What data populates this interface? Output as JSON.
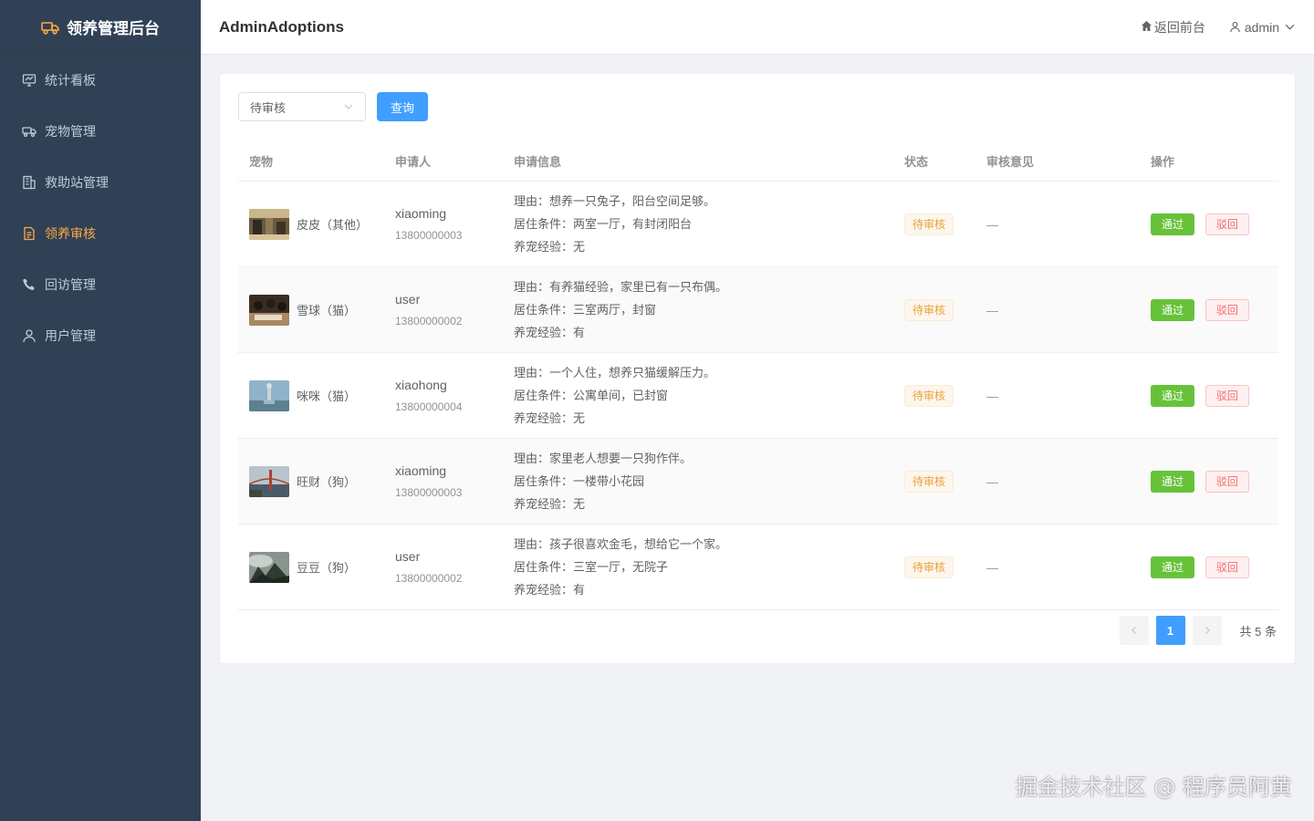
{
  "brand": {
    "title": "领养管理后台",
    "icon": "truck-icon",
    "accent": "#ffa940"
  },
  "sidebar": {
    "items": [
      {
        "label": "统计看板",
        "icon": "dashboard-icon",
        "active": false
      },
      {
        "label": "宠物管理",
        "icon": "truck-icon",
        "active": false
      },
      {
        "label": "救助站管理",
        "icon": "building-icon",
        "active": false
      },
      {
        "label": "领养审核",
        "icon": "document-icon",
        "active": true
      },
      {
        "label": "回访管理",
        "icon": "phone-icon",
        "active": false
      },
      {
        "label": "用户管理",
        "icon": "user-icon",
        "active": false
      }
    ]
  },
  "header": {
    "title": "AdminAdoptions",
    "back_link": "返回前台",
    "user": "admin"
  },
  "filter": {
    "status_value": "待审核",
    "query_label": "查询"
  },
  "table": {
    "columns": [
      "宠物",
      "申请人",
      "申请信息",
      "状态",
      "审核意见",
      "操作"
    ],
    "rows": [
      {
        "pet": "皮皮（其他）",
        "applicant": "xiaoming",
        "phone": "13800000003",
        "reason": "理由：想养一只兔子，阳台空间足够。",
        "living": "居住条件：两室一厅，有封闭阳台",
        "experience": "养宠经验：无",
        "status": "待审核",
        "review": "—",
        "approve": "通过",
        "reject": "驳回"
      },
      {
        "pet": "雪球（猫）",
        "applicant": "user",
        "phone": "13800000002",
        "reason": "理由：有养猫经验，家里已有一只布偶。",
        "living": "居住条件：三室两厅，封窗",
        "experience": "养宠经验：有",
        "status": "待审核",
        "review": "—",
        "approve": "通过",
        "reject": "驳回"
      },
      {
        "pet": "咪咪（猫）",
        "applicant": "xiaohong",
        "phone": "13800000004",
        "reason": "理由：一个人住，想养只猫缓解压力。",
        "living": "居住条件：公寓单间，已封窗",
        "experience": "养宠经验：无",
        "status": "待审核",
        "review": "—",
        "approve": "通过",
        "reject": "驳回"
      },
      {
        "pet": "旺财（狗）",
        "applicant": "xiaoming",
        "phone": "13800000003",
        "reason": "理由：家里老人想要一只狗作伴。",
        "living": "居住条件：一楼带小花园",
        "experience": "养宠经验：无",
        "status": "待审核",
        "review": "—",
        "approve": "通过",
        "reject": "驳回"
      },
      {
        "pet": "豆豆（狗）",
        "applicant": "user",
        "phone": "13800000002",
        "reason": "理由：孩子很喜欢金毛，想给它一个家。",
        "living": "居住条件：三室一厅，无院子",
        "experience": "养宠经验：有",
        "status": "待审核",
        "review": "—",
        "approve": "通过",
        "reject": "驳回"
      }
    ]
  },
  "pagination": {
    "current": "1",
    "total_text": "共 5 条"
  },
  "watermark": "掘金技术社区 @ 程序员阿黄",
  "colors": {
    "sidebar_bg": "#304156",
    "primary": "#409eff",
    "success": "#67c23a",
    "danger": "#f56c6c",
    "warning": "#e6a23c"
  }
}
